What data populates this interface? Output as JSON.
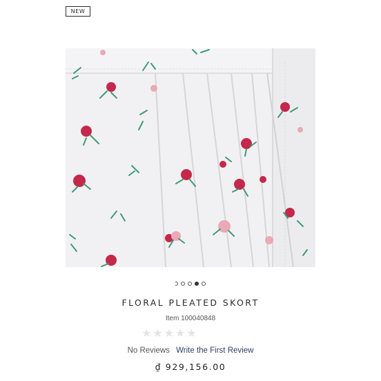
{
  "badge": {
    "label": "NEW"
  },
  "gallery": {
    "image_description": "floral-pleated-skort-photo",
    "dots_total": 5,
    "active_index": 3
  },
  "product": {
    "title": "FLORAL PLEATED SKORT",
    "item_number": "Item 100040848",
    "rating": 0,
    "rating_max": 5,
    "no_reviews_label": "No Reviews",
    "write_review_label": "Write the First Review",
    "price": "₫ 929,156.00"
  },
  "colors": {
    "fabric": "#f1f1f3",
    "flower_red": "#c4284a",
    "flower_pink": "#eaa9b6",
    "leaf_green": "#3f9a73",
    "link": "#2c3e66",
    "star_empty": "#e4e4e4"
  }
}
